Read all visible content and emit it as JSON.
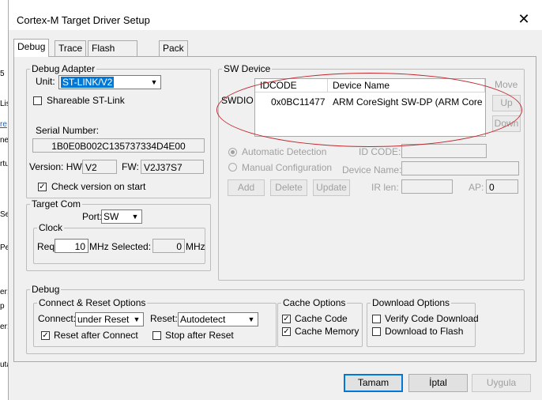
{
  "background_fragments": [
    "5",
    "Lis",
    "re",
    "ne",
    "rtu",
    "Set",
    "Pe",
    "er:",
    "p",
    "er:",
    "uta"
  ],
  "window": {
    "title": "Cortex-M Target Driver Setup",
    "close_glyph": "✕"
  },
  "tabs": [
    "Debug",
    "Trace",
    "Flash Download",
    "Pack"
  ],
  "debug_adapter": {
    "legend": "Debug Adapter",
    "unit_label": "Unit:",
    "unit_value": "ST-LINK/V2",
    "shareable_label": "Shareable ST-Link",
    "serial_label": "Serial Number:",
    "serial_value": "1B0E0B002C135737334D4E00",
    "version_label": "Version: HW:",
    "hw_value": "V2",
    "fw_label": "FW:",
    "fw_value": "V2J37S7",
    "check_version_label": "Check version on start"
  },
  "target_com": {
    "legend": "Target Com",
    "port_label": "Port:",
    "port_value": "SW",
    "clock_legend": "Clock",
    "req_label": "Req:",
    "req_value": "10",
    "mhz1": "MHz",
    "selected_label": "Selected:",
    "selected_value": "0",
    "mhz2": "MHz"
  },
  "sw_device": {
    "legend": "SW Device",
    "move_label": "Move",
    "up_label": "Up",
    "down_label": "Down",
    "swdio_label": "SWDIO",
    "columns": [
      "IDCODE",
      "Device Name"
    ],
    "rows": [
      {
        "idcode": "0x0BC11477",
        "device_name": "ARM CoreSight SW-DP (ARM Core"
      }
    ],
    "auto_detect_label": "Automatic Detection",
    "manual_config_label": "Manual Configuration",
    "id_code_label": "ID CODE:",
    "device_name_label": "Device Name:",
    "add_label": "Add",
    "delete_label": "Delete",
    "update_label": "Update",
    "ir_len_label": "IR len:",
    "ap_label": "AP:",
    "ap_value": "0"
  },
  "debug": {
    "legend": "Debug",
    "connect_reset": {
      "legend": "Connect & Reset Options",
      "connect_label": "Connect:",
      "connect_value": "under Reset",
      "reset_label": "Reset:",
      "reset_value": "Autodetect",
      "reset_after_connect_label": "Reset after Connect",
      "stop_after_reset_label": "Stop after Reset"
    },
    "cache": {
      "legend": "Cache Options",
      "cache_code_label": "Cache Code",
      "cache_memory_label": "Cache Memory"
    },
    "download": {
      "legend": "Download Options",
      "verify_label": "Verify Code Download",
      "download_flash_label": "Download to Flash"
    }
  },
  "footer": {
    "ok_label": "Tamam",
    "cancel_label": "İptal",
    "apply_label": "Uygula"
  },
  "colors": {
    "annotation_ellipse": "#c0272d",
    "selection": "#0078d7"
  }
}
